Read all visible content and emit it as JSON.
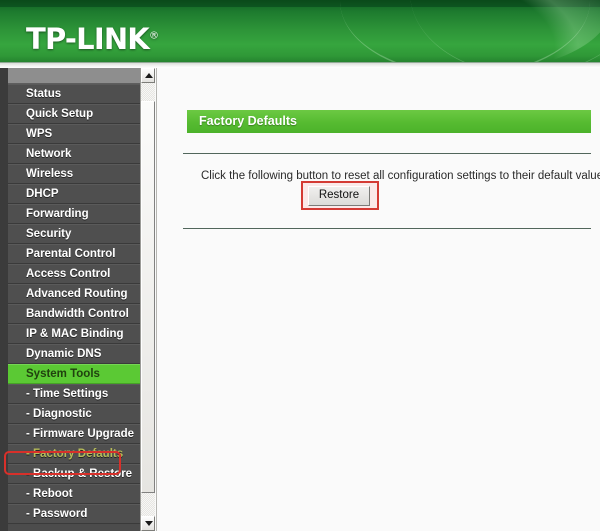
{
  "header": {
    "brand": "TP-LINK",
    "registered_mark": "®"
  },
  "sidebar": {
    "items": [
      {
        "label": "Status",
        "type": "main",
        "state": "normal"
      },
      {
        "label": "Quick Setup",
        "type": "main",
        "state": "normal"
      },
      {
        "label": "WPS",
        "type": "main",
        "state": "normal"
      },
      {
        "label": "Network",
        "type": "main",
        "state": "normal"
      },
      {
        "label": "Wireless",
        "type": "main",
        "state": "normal"
      },
      {
        "label": "DHCP",
        "type": "main",
        "state": "normal"
      },
      {
        "label": "Forwarding",
        "type": "main",
        "state": "normal"
      },
      {
        "label": "Security",
        "type": "main",
        "state": "normal"
      },
      {
        "label": "Parental Control",
        "type": "main",
        "state": "normal"
      },
      {
        "label": "Access Control",
        "type": "main",
        "state": "normal"
      },
      {
        "label": "Advanced Routing",
        "type": "main",
        "state": "normal"
      },
      {
        "label": "Bandwidth Control",
        "type": "main",
        "state": "normal"
      },
      {
        "label": "IP & MAC Binding",
        "type": "main",
        "state": "normal"
      },
      {
        "label": "Dynamic DNS",
        "type": "main",
        "state": "normal"
      },
      {
        "label": "System Tools",
        "type": "main",
        "state": "active-group"
      },
      {
        "label": "- Time Settings",
        "type": "sub",
        "state": "normal"
      },
      {
        "label": "- Diagnostic",
        "type": "sub",
        "state": "normal"
      },
      {
        "label": "- Firmware Upgrade",
        "type": "sub",
        "state": "normal"
      },
      {
        "label": "- Factory Defaults",
        "type": "sub",
        "state": "selected"
      },
      {
        "label": "- Backup & Restore",
        "type": "sub",
        "state": "normal"
      },
      {
        "label": "- Reboot",
        "type": "sub",
        "state": "normal"
      },
      {
        "label": "- Password",
        "type": "sub",
        "state": "normal"
      }
    ],
    "scrollbar": {
      "up_arrow": "scroll-up-arrow",
      "down_arrow": "scroll-down-arrow"
    }
  },
  "main": {
    "panel_title": "Factory Defaults",
    "instruction": "Click the following button to reset all configuration settings to their default values.",
    "restore_label": "Restore"
  },
  "annotations": {
    "sidebar_highlight_target": "- Factory Defaults",
    "button_highlight_target": "Restore",
    "color": "#d8302a"
  },
  "colors": {
    "banner_green": "#2d9438",
    "accent_green": "#5bc934",
    "panel_header_green": "#56bb31",
    "sidebar_gray": "#4f4f4f",
    "selected_sub_text": "#b5bb5a",
    "annotation_red": "#d8302a",
    "content_bg": "#fafafa"
  }
}
